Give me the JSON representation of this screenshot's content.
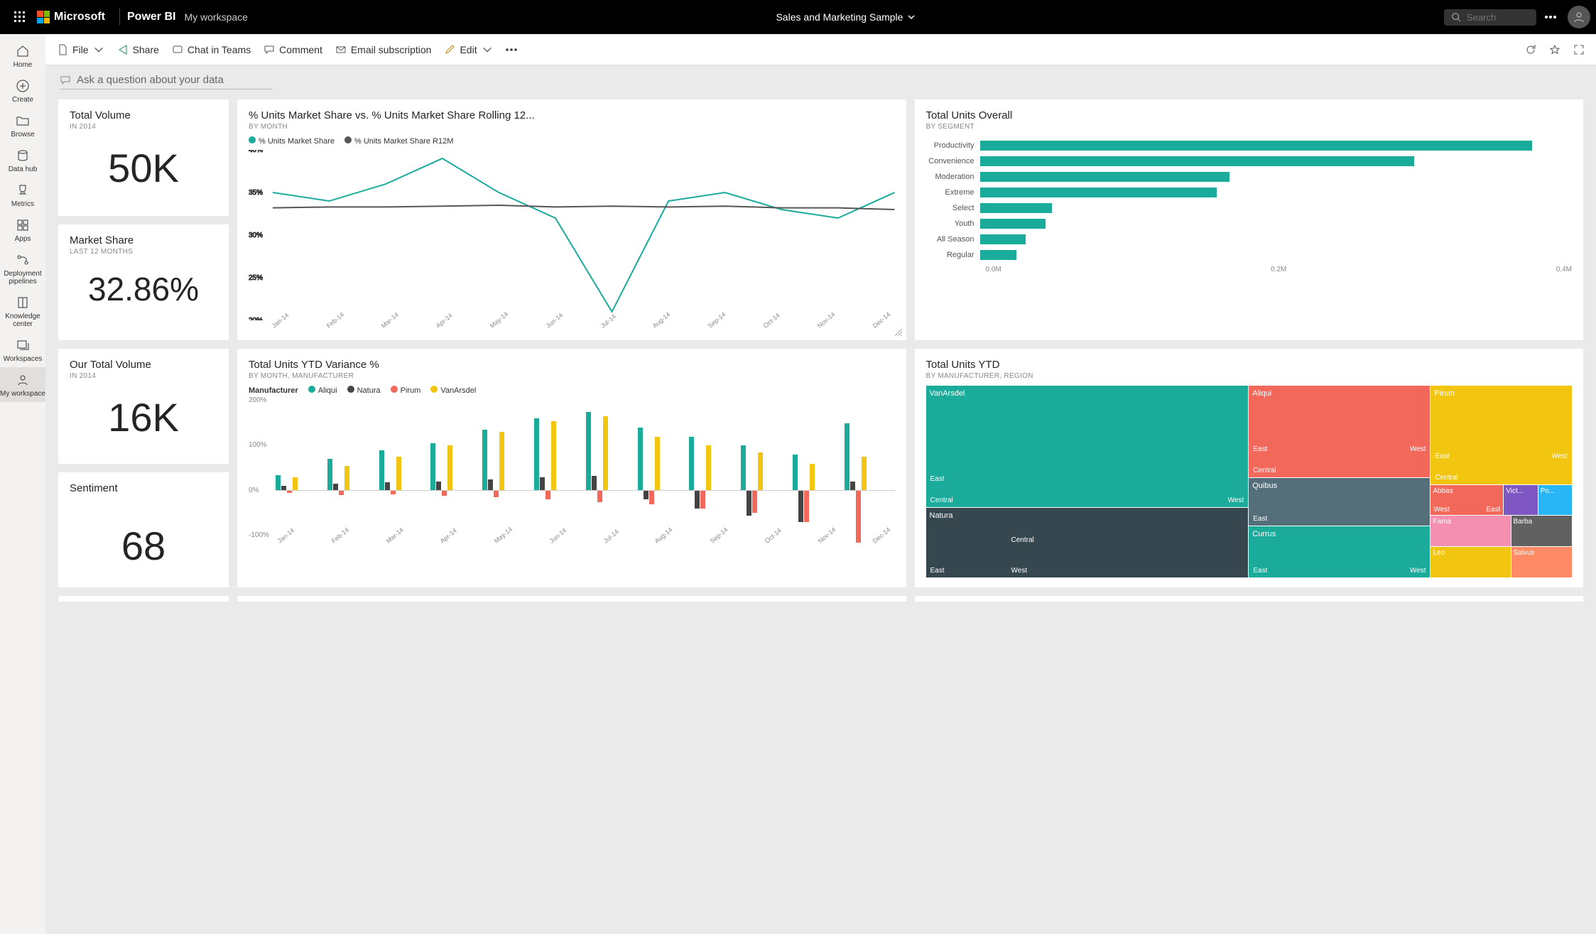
{
  "topbar": {
    "ms": "Microsoft",
    "brand": "Power BI",
    "workspace": "My workspace",
    "report_title": "Sales and Marketing Sample",
    "search_placeholder": "Search"
  },
  "leftnav": [
    {
      "label": "Home",
      "icon": "home"
    },
    {
      "label": "Create",
      "icon": "plus"
    },
    {
      "label": "Browse",
      "icon": "folder"
    },
    {
      "label": "Data hub",
      "icon": "data"
    },
    {
      "label": "Metrics",
      "icon": "trophy"
    },
    {
      "label": "Apps",
      "icon": "apps"
    },
    {
      "label": "Deployment pipelines",
      "icon": "pipe"
    },
    {
      "label": "Knowledge center",
      "icon": "book"
    },
    {
      "label": "Workspaces",
      "icon": "stack"
    },
    {
      "label": "My workspace",
      "icon": "user",
      "active": true
    }
  ],
  "actionbar": {
    "file": "File",
    "share": "Share",
    "chat": "Chat in Teams",
    "comment": "Comment",
    "email": "Email subscription",
    "edit": "Edit"
  },
  "qa_placeholder": "Ask a question about your data",
  "tiles": {
    "total_volume": {
      "title": "Total Volume",
      "sub": "IN 2014",
      "value": "50K"
    },
    "market_share": {
      "title": "Market Share",
      "sub": "LAST 12 MONTHS",
      "value": "32.86%"
    },
    "our_volume": {
      "title": "Our Total Volume",
      "sub": "IN 2014",
      "value": "16K"
    },
    "sentiment": {
      "title": "Sentiment",
      "value": "68"
    },
    "line": {
      "title": "% Units Market Share vs. % Units Market Share Rolling 12...",
      "sub": "BY MONTH",
      "legend": [
        "% Units Market Share",
        "% Units Market Share R12M"
      ]
    },
    "hbar": {
      "title": "Total Units Overall",
      "sub": "BY SEGMENT",
      "xticks": [
        "0.0M",
        "0.2M",
        "0.4M"
      ]
    },
    "vbar": {
      "title": "Total Units YTD Variance %",
      "sub": "BY MONTH, MANUFACTURER",
      "legendtitle": "Manufacturer",
      "legend": [
        "Aliqui",
        "Natura",
        "Pirum",
        "VanArsdel"
      ]
    },
    "tree": {
      "title": "Total Units YTD",
      "sub": "BY MANUFACTURER, REGION"
    }
  },
  "chart_data": {
    "line": {
      "type": "line",
      "x": [
        "Jan-14",
        "Feb-14",
        "Mar-14",
        "Apr-14",
        "May-14",
        "Jun-14",
        "Jul-14",
        "Aug-14",
        "Sep-14",
        "Oct-14",
        "Nov-14",
        "Dec-14"
      ],
      "series": [
        {
          "name": "% Units Market Share",
          "values": [
            35,
            34,
            36,
            39,
            35,
            32,
            21,
            34,
            35,
            33,
            32,
            35
          ],
          "color": "#1aab9b"
        },
        {
          "name": "% Units Market Share R12M",
          "values": [
            33.2,
            33.3,
            33.3,
            33.4,
            33.5,
            33.3,
            33.4,
            33.3,
            33.4,
            33.2,
            33.2,
            33.0
          ],
          "color": "#555"
        }
      ],
      "ylim": [
        20,
        40
      ],
      "yticks": [
        20,
        25,
        30,
        35,
        40
      ]
    },
    "hbar": {
      "type": "bar",
      "orientation": "h",
      "categories": [
        "Productivity",
        "Convenience",
        "Moderation",
        "Extreme",
        "Select",
        "Youth",
        "All Season",
        "Regular"
      ],
      "values": [
        0.42,
        0.33,
        0.19,
        0.18,
        0.055,
        0.05,
        0.035,
        0.028
      ],
      "xlim": [
        0,
        0.45
      ],
      "color": "#1aab9b"
    },
    "vbar": {
      "type": "bar",
      "grouped": true,
      "x": [
        "Jan-14",
        "Feb-14",
        "Mar-14",
        "Apr-14",
        "May-14",
        "Jun-14",
        "Jul-14",
        "Aug-14",
        "Sep-14",
        "Oct-14",
        "Nov-14",
        "Dec-14"
      ],
      "series": [
        {
          "name": "Aliqui",
          "color": "#1aab9b",
          "values": [
            35,
            70,
            90,
            105,
            135,
            160,
            175,
            140,
            120,
            100,
            80,
            150
          ]
        },
        {
          "name": "Natura",
          "color": "#444",
          "values": [
            10,
            15,
            18,
            20,
            25,
            30,
            32,
            -20,
            -40,
            -55,
            -70,
            20
          ]
        },
        {
          "name": "Pirum",
          "color": "#f2695c",
          "values": [
            -5,
            -10,
            -8,
            -12,
            -15,
            -20,
            -25,
            -30,
            -40,
            -50,
            -70,
            -115
          ]
        },
        {
          "name": "VanArsdel",
          "color": "#f2c511",
          "values": [
            30,
            55,
            75,
            100,
            130,
            155,
            165,
            120,
            100,
            85,
            60,
            75
          ]
        }
      ],
      "ylim": [
        -100,
        200
      ],
      "yticks": [
        -100,
        0,
        100,
        200
      ]
    },
    "tree": {
      "type": "treemap",
      "items": [
        {
          "name": "VanArsdel",
          "value": 340,
          "color": "#1aab9b",
          "children": [
            "East",
            "Central",
            "West"
          ]
        },
        {
          "name": "Natura",
          "value": 120,
          "color": "#37474f",
          "children": [
            "East",
            "Central",
            "West"
          ]
        },
        {
          "name": "Aliqui",
          "value": 130,
          "color": "#f2695c",
          "children": [
            "East",
            "Central",
            "West"
          ]
        },
        {
          "name": "Pirum",
          "value": 70,
          "color": "#f2c511",
          "children": [
            "East",
            "Central",
            "West"
          ]
        },
        {
          "name": "Quibus",
          "value": 40,
          "color": "#546e7a",
          "children": [
            "East"
          ]
        },
        {
          "name": "Currus",
          "value": 30,
          "color": "#1aab9b",
          "children": [
            "East",
            "West"
          ]
        },
        {
          "name": "Abbas",
          "value": 22,
          "color": "#f2695c",
          "children": [
            "West",
            "East"
          ]
        },
        {
          "name": "Fama",
          "value": 20,
          "color": "#f48fb1",
          "children": []
        },
        {
          "name": "Leo",
          "value": 18,
          "color": "#f2c511",
          "children": []
        },
        {
          "name": "Victoria",
          "value": 15,
          "color": "#7e57c2",
          "children": []
        },
        {
          "name": "Pomum",
          "value": 12,
          "color": "#29b6f6",
          "children": []
        },
        {
          "name": "Barba",
          "value": 12,
          "color": "#616161",
          "children": []
        },
        {
          "name": "Salvus",
          "value": 12,
          "color": "#ff8a65",
          "children": []
        }
      ]
    }
  }
}
